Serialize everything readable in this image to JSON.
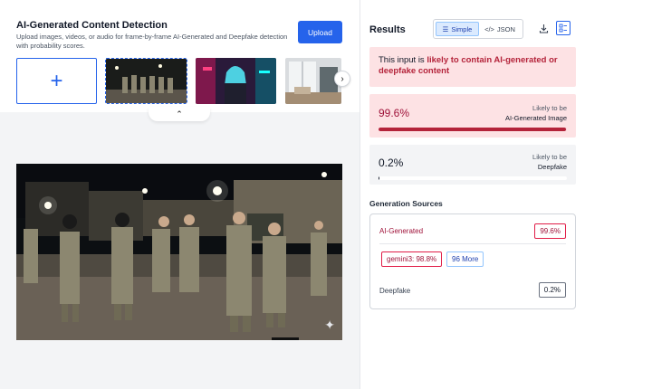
{
  "upload_panel": {
    "title": "AI-Generated Content Detection",
    "subtitle": "Upload images, videos, or audio for frame-by-frame AI-Generated and Deepfake detection with probability scores.",
    "upload_label": "Upload",
    "add_symbol": "+",
    "next_symbol": "›",
    "collapse_symbol": "⌃"
  },
  "results": {
    "title": "Results",
    "view_toggle": {
      "simple": {
        "icon": "☰",
        "label": "Simple"
      },
      "json": {
        "icon": "</>",
        "label": "JSON"
      }
    },
    "alert": {
      "prefix": "This input is ",
      "highlight": "likely to contain AI-generated or deepfake content"
    },
    "ai_score": {
      "value": "99.6%",
      "fill_percent": 99.6,
      "label_line1": "Likely to be",
      "label_line2": "AI-Generated Image"
    },
    "deepfake_score": {
      "value": "0.2%",
      "fill_percent": 0.2,
      "label_line1": "Likely to be",
      "label_line2": "Deepfake"
    },
    "generation_sources": {
      "title": "Generation Sources",
      "ai_label": "AI-Generated",
      "ai_value": "99.6%",
      "model_pill": "gemini3: 98.8%",
      "more_pill": "96 More",
      "deepfake_label": "Deepfake",
      "deepfake_value": "0.2%"
    }
  },
  "colors": {
    "accent": "#2563eb",
    "danger": "#b4233a",
    "danger_bg": "#fde2e4"
  }
}
